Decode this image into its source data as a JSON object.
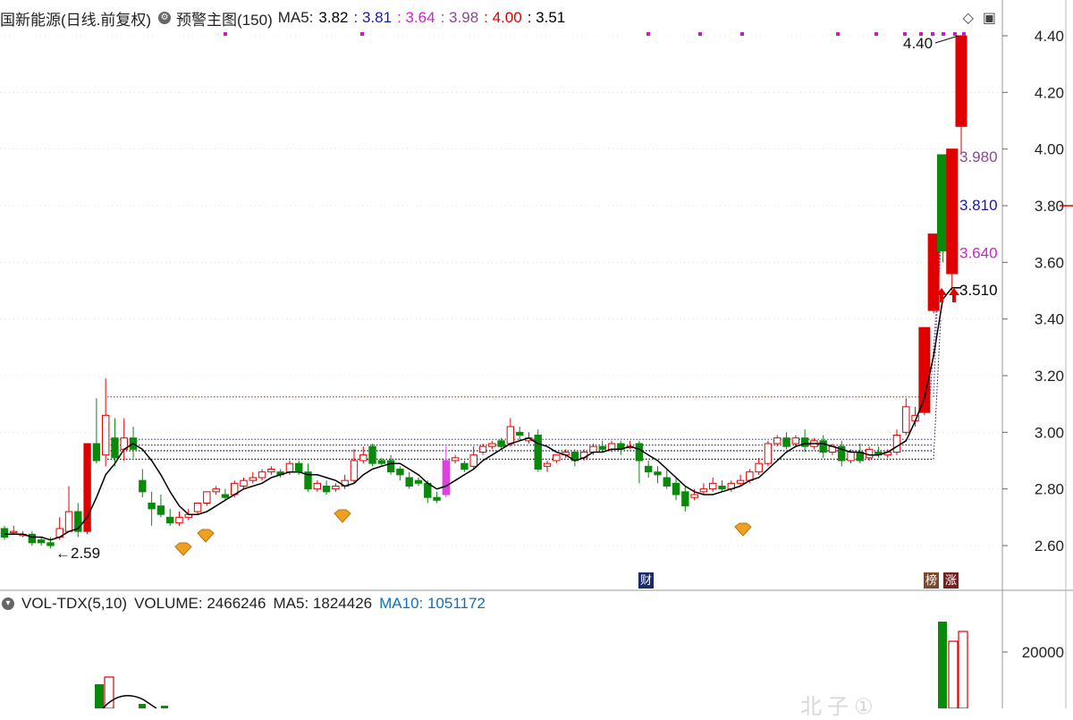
{
  "header": {
    "stock_name": "国新能源(日线.前复权)",
    "indicator_name": "预警主图(150)",
    "ma_label": "MA5:",
    "values": [
      {
        "text": "3.82",
        "color": "#000000"
      },
      {
        "text": ": 3.81",
        "color": "#1a1aa0"
      },
      {
        "text": ": 3.64",
        "color": "#d020d0"
      },
      {
        "text": ": 3.98",
        "color": "#8a4a8a"
      },
      {
        "text": ": 4.00",
        "color": "#e00000"
      },
      {
        "text": ": 3.51",
        "color": "#000000"
      }
    ]
  },
  "volume_header": {
    "name": "VOL-TDX(5,10)",
    "volume": "VOLUME: 2466246",
    "ma5": "MA5: 1824426",
    "ma10": "MA10: 1051172"
  },
  "badges": {
    "cai": "财",
    "bang": "榜",
    "zhang": "涨"
  },
  "colors": {
    "up": "#e00000",
    "down": "#0a8a0a",
    "ma": "#000000",
    "grid": "#c8c8c8"
  },
  "chart_data": {
    "type": "candlestick",
    "y_axis": {
      "ticks": [
        "2.60",
        "2.80",
        "3.00",
        "3.20",
        "3.40",
        "3.60",
        "3.80",
        "4.00",
        "4.20",
        "4.40"
      ],
      "ylim": [
        2.54,
        4.46
      ]
    },
    "candles": [
      [
        2.66,
        2.67,
        2.63,
        2.62
      ],
      [
        2.65,
        2.67,
        2.65,
        2.64
      ],
      [
        2.64,
        2.65,
        2.64,
        2.63
      ],
      [
        2.64,
        2.65,
        2.61,
        2.6
      ],
      [
        2.62,
        2.63,
        2.61,
        2.6
      ],
      [
        2.61,
        2.63,
        2.6,
        2.59
      ],
      [
        2.63,
        2.7,
        2.66,
        2.62
      ],
      [
        2.65,
        2.81,
        2.72,
        2.65
      ],
      [
        2.72,
        2.75,
        2.65,
        2.63
      ],
      [
        2.65,
        2.96,
        2.96,
        2.64
      ],
      [
        2.96,
        3.12,
        2.9,
        2.89
      ],
      [
        2.92,
        3.19,
        3.06,
        2.88
      ],
      [
        2.98,
        3.05,
        2.91,
        2.88
      ],
      [
        2.94,
        3.05,
        2.98,
        2.9
      ],
      [
        2.98,
        3.02,
        2.94,
        2.91
      ],
      [
        2.83,
        2.87,
        2.79,
        2.77
      ],
      [
        2.75,
        2.79,
        2.73,
        2.67
      ],
      [
        2.74,
        2.78,
        2.71,
        2.7
      ],
      [
        2.7,
        2.73,
        2.68,
        2.67
      ],
      [
        2.68,
        2.72,
        2.7,
        2.67
      ],
      [
        2.7,
        2.73,
        2.71,
        2.69
      ],
      [
        2.72,
        2.75,
        2.75,
        2.71
      ],
      [
        2.75,
        2.79,
        2.79,
        2.74
      ],
      [
        2.79,
        2.81,
        2.8,
        2.78
      ],
      [
        2.78,
        2.8,
        2.77,
        2.76
      ],
      [
        2.78,
        2.83,
        2.82,
        2.77
      ],
      [
        2.81,
        2.84,
        2.83,
        2.8
      ],
      [
        2.83,
        2.86,
        2.84,
        2.82
      ],
      [
        2.84,
        2.87,
        2.86,
        2.83
      ],
      [
        2.86,
        2.88,
        2.87,
        2.85
      ],
      [
        2.86,
        2.87,
        2.85,
        2.84
      ],
      [
        2.86,
        2.9,
        2.89,
        2.85
      ],
      [
        2.89,
        2.9,
        2.86,
        2.85
      ],
      [
        2.86,
        2.89,
        2.8,
        2.79
      ],
      [
        2.8,
        2.83,
        2.82,
        2.79
      ],
      [
        2.81,
        2.83,
        2.79,
        2.78
      ],
      [
        2.8,
        2.82,
        2.81,
        2.79
      ],
      [
        2.81,
        2.85,
        2.83,
        2.8
      ],
      [
        2.83,
        2.94,
        2.9,
        2.82
      ],
      [
        2.9,
        2.95,
        2.92,
        2.89
      ],
      [
        2.95,
        2.96,
        2.89,
        2.88
      ],
      [
        2.9,
        2.91,
        2.89,
        2.88
      ],
      [
        2.9,
        2.92,
        2.86,
        2.85
      ],
      [
        2.87,
        2.88,
        2.85,
        2.83
      ],
      [
        2.84,
        2.86,
        2.81,
        2.8
      ],
      [
        2.83,
        2.84,
        2.82,
        2.81
      ],
      [
        2.82,
        2.83,
        2.77,
        2.75
      ],
      [
        2.77,
        2.79,
        2.76,
        2.75
      ],
      [
        2.78,
        2.95,
        2.9,
        2.77
      ],
      [
        2.9,
        2.92,
        2.91,
        2.89
      ],
      [
        2.89,
        2.9,
        2.87,
        2.86
      ],
      [
        2.88,
        2.95,
        2.92,
        2.87
      ],
      [
        2.93,
        2.96,
        2.95,
        2.92
      ],
      [
        2.95,
        2.97,
        2.96,
        2.94
      ],
      [
        2.97,
        2.98,
        2.95,
        2.94
      ],
      [
        2.96,
        3.05,
        3.02,
        2.95
      ],
      [
        3.0,
        3.02,
        2.99,
        2.97
      ],
      [
        2.97,
        3.0,
        2.98,
        2.96
      ],
      [
        2.99,
        3.01,
        2.87,
        2.86
      ],
      [
        2.88,
        2.9,
        2.89,
        2.86
      ],
      [
        2.9,
        2.92,
        2.92,
        2.89
      ],
      [
        2.92,
        2.94,
        2.93,
        2.91
      ],
      [
        2.93,
        2.94,
        2.9,
        2.88
      ],
      [
        2.91,
        2.94,
        2.93,
        2.9
      ],
      [
        2.93,
        2.96,
        2.95,
        2.92
      ],
      [
        2.95,
        2.97,
        2.94,
        2.93
      ],
      [
        2.94,
        2.97,
        2.96,
        2.93
      ],
      [
        2.96,
        2.97,
        2.94,
        2.92
      ],
      [
        2.95,
        2.97,
        2.95,
        2.94
      ],
      [
        2.96,
        2.97,
        2.9,
        2.82
      ],
      [
        2.88,
        2.9,
        2.86,
        2.84
      ],
      [
        2.86,
        2.88,
        2.85,
        2.82
      ],
      [
        2.84,
        2.87,
        2.81,
        2.8
      ],
      [
        2.82,
        2.84,
        2.78,
        2.76
      ],
      [
        2.79,
        2.81,
        2.74,
        2.72
      ],
      [
        2.77,
        2.8,
        2.78,
        2.76
      ],
      [
        2.79,
        2.82,
        2.8,
        2.78
      ],
      [
        2.8,
        2.84,
        2.82,
        2.79
      ],
      [
        2.81,
        2.83,
        2.8,
        2.79
      ],
      [
        2.8,
        2.83,
        2.82,
        2.79
      ],
      [
        2.82,
        2.85,
        2.83,
        2.81
      ],
      [
        2.83,
        2.87,
        2.86,
        2.82
      ],
      [
        2.86,
        2.91,
        2.89,
        2.85
      ],
      [
        2.89,
        2.97,
        2.96,
        2.88
      ],
      [
        2.96,
        2.99,
        2.98,
        2.95
      ],
      [
        2.98,
        3.0,
        2.95,
        2.94
      ],
      [
        2.96,
        2.99,
        2.98,
        2.95
      ],
      [
        2.98,
        3.01,
        2.95,
        2.93
      ],
      [
        2.95,
        2.98,
        2.97,
        2.94
      ],
      [
        2.97,
        2.99,
        2.93,
        2.91
      ],
      [
        2.93,
        2.96,
        2.95,
        2.92
      ],
      [
        2.95,
        2.97,
        2.9,
        2.88
      ],
      [
        2.9,
        2.94,
        2.93,
        2.89
      ],
      [
        2.93,
        2.96,
        2.9,
        2.89
      ],
      [
        2.91,
        2.95,
        2.94,
        2.9
      ],
      [
        2.93,
        2.95,
        2.92,
        2.91
      ],
      [
        2.92,
        2.94,
        2.93,
        2.91
      ],
      [
        2.93,
        3.01,
        2.99,
        2.92
      ],
      [
        3.0,
        3.12,
        3.09,
        2.99
      ],
      [
        3.04,
        3.09,
        3.06,
        3.02
      ],
      [
        3.07,
        3.37,
        3.37,
        3.06
      ],
      [
        3.43,
        3.7,
        3.7,
        3.42
      ],
      [
        3.98,
        3.98,
        3.64,
        3.6
      ],
      [
        3.56,
        4.0,
        4.0,
        3.5
      ],
      [
        4.08,
        4.4,
        4.4,
        3.98
      ]
    ],
    "ma5": [
      2.64,
      2.64,
      2.64,
      2.63,
      2.63,
      2.62,
      2.63,
      2.65,
      2.66,
      2.7,
      2.77,
      2.85,
      2.89,
      2.94,
      2.96,
      2.94,
      2.9,
      2.85,
      2.79,
      2.74,
      2.71,
      2.71,
      2.72,
      2.74,
      2.76,
      2.78,
      2.8,
      2.81,
      2.82,
      2.84,
      2.85,
      2.86,
      2.86,
      2.85,
      2.85,
      2.84,
      2.83,
      2.81,
      2.82,
      2.85,
      2.87,
      2.88,
      2.89,
      2.89,
      2.87,
      2.85,
      2.82,
      2.8,
      2.81,
      2.83,
      2.85,
      2.87,
      2.9,
      2.92,
      2.94,
      2.96,
      2.97,
      2.98,
      2.96,
      2.95,
      2.93,
      2.92,
      2.9,
      2.91,
      2.93,
      2.93,
      2.94,
      2.94,
      2.95,
      2.94,
      2.92,
      2.9,
      2.87,
      2.84,
      2.81,
      2.79,
      2.78,
      2.78,
      2.79,
      2.8,
      2.81,
      2.83,
      2.84,
      2.87,
      2.9,
      2.93,
      2.95,
      2.96,
      2.96,
      2.96,
      2.95,
      2.94,
      2.93,
      2.93,
      2.92,
      2.92,
      2.93,
      2.95,
      2.97,
      3.04,
      3.12,
      3.27,
      3.47,
      3.51,
      3.51
    ],
    "zones": [
      {
        "value": 3.125,
        "color": "#c04040"
      },
      {
        "value": 2.975,
        "color": "#5050d0"
      },
      {
        "value": 2.955,
        "color": "#404080"
      },
      {
        "value": 2.935,
        "color": "#202060"
      },
      {
        "value": 2.905,
        "color": "#202020"
      }
    ],
    "annotations": {
      "low": {
        "text": "←2.59",
        "value": 2.59
      },
      "high": {
        "text": "4.40",
        "value": 4.4
      },
      "price_labels": [
        {
          "text": "3.980",
          "value": 3.98,
          "color": "#8a4a8a"
        },
        {
          "text": "3.810",
          "value": 3.81,
          "color": "#1a1aa0"
        },
        {
          "text": "3.640",
          "value": 3.64,
          "color": "#d020d0"
        },
        {
          "text": "3.510",
          "value": 3.51,
          "color": "#000000"
        }
      ]
    },
    "top_markers": [
      8,
      13,
      23,
      26,
      28,
      30,
      32,
      33,
      34
    ],
    "diamond_markers": [
      16,
      18,
      31,
      69
    ],
    "volume": {
      "y_ticks": [
        "20000"
      ],
      "bars": [
        {
          "color": "#0a8a0a",
          "value": 23000,
          "h": 34
        },
        {
          "color": "#e00000",
          "value": 18000,
          "h": 44
        },
        {
          "color": "#e00000",
          "value": 21000,
          "h": 40
        }
      ],
      "early_bars": [
        {
          "color": "#0a8a0a",
          "value": 2500
        },
        {
          "color": "#e00000",
          "value": 3300
        }
      ]
    }
  },
  "watermark": "北子①"
}
